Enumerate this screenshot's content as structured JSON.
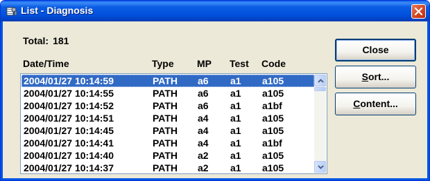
{
  "window": {
    "title": "List - Diagnosis",
    "icon": "list-app-icon",
    "close_icon": "close-icon",
    "accent": "#0054e3",
    "close_color": "#d2431d"
  },
  "summary": {
    "total_label": "Total:",
    "total_value": "181"
  },
  "list": {
    "columns": [
      "Date/Time",
      "Type",
      "MP",
      "Test",
      "Code"
    ],
    "selected_index": 0,
    "selection_color": "#316ac5",
    "rows": [
      {
        "datetime": "2004/01/27 10:14:59",
        "type": "PATH",
        "mp": "a6",
        "test": "a1",
        "code": "a105"
      },
      {
        "datetime": "2004/01/27 10:14:55",
        "type": "PATH",
        "mp": "a6",
        "test": "a1",
        "code": "a105"
      },
      {
        "datetime": "2004/01/27 10:14:52",
        "type": "PATH",
        "mp": "a6",
        "test": "a1",
        "code": "a1bf"
      },
      {
        "datetime": "2004/01/27 10:14:51",
        "type": "PATH",
        "mp": "a4",
        "test": "a1",
        "code": "a105"
      },
      {
        "datetime": "2004/01/27 10:14:45",
        "type": "PATH",
        "mp": "a4",
        "test": "a1",
        "code": "a105"
      },
      {
        "datetime": "2004/01/27 10:14:41",
        "type": "PATH",
        "mp": "a4",
        "test": "a1",
        "code": "a1bf"
      },
      {
        "datetime": "2004/01/27 10:14:40",
        "type": "PATH",
        "mp": "a2",
        "test": "a1",
        "code": "a105"
      },
      {
        "datetime": "2004/01/27 10:14:37",
        "type": "PATH",
        "mp": "a2",
        "test": "a1",
        "code": "a105"
      }
    ]
  },
  "scrollbar": {
    "up_icon": "arrow-up-icon",
    "down_icon": "arrow-down-icon",
    "position": 0
  },
  "buttons": {
    "close": {
      "label": "Close"
    },
    "sort": {
      "mnemonic": "S",
      "rest": "ort..."
    },
    "content": {
      "mnemonic": "C",
      "rest": "ontent..."
    }
  }
}
